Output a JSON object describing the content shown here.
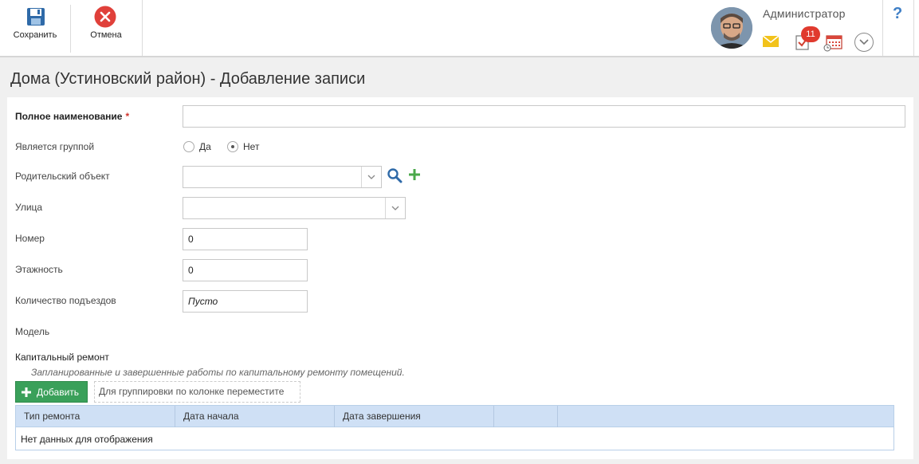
{
  "toolbar": {
    "save_label": "Сохранить",
    "cancel_label": "Отмена",
    "icons": {
      "save": "floppy-disk-icon",
      "cancel": "close-circle-icon"
    }
  },
  "user": {
    "name": "Администратор",
    "notifications_count": "11",
    "icons": [
      "mail-icon",
      "tasks-icon",
      "calendar-icon",
      "chevron-down-icon"
    ],
    "help_label": "?"
  },
  "page": {
    "title": "Дома (Устиновский район) - Добавление записи"
  },
  "form": {
    "full_name_label": "Полное наименование",
    "required_mark": "*",
    "full_name_value": "",
    "is_group_label": "Является группой",
    "is_group_options": [
      "Да",
      "Нет"
    ],
    "is_group_selected": "Нет",
    "parent_label": "Родительский объект",
    "parent_value": "",
    "street_label": "Улица",
    "street_value": "",
    "number_label": "Номер",
    "number_value": "0",
    "floors_label": "Этажность",
    "floors_value": "0",
    "entrances_label": "Количество подъездов",
    "entrances_placeholder": "Пусто",
    "model_label": "Модель"
  },
  "repairs": {
    "title": "Капитальный ремонт",
    "description": "Запланированные и завершенные работы по капитальному ремонту помещений.",
    "add_label": "Добавить",
    "group_hint": "Для группировки по колонке переместите",
    "columns": [
      "Тип ремонта",
      "Дата начала",
      "Дата завершения",
      ""
    ],
    "empty_text": "Нет данных для отображения"
  },
  "colors": {
    "accent_green": "#3aa05a",
    "grid_header": "#cfe0f5",
    "badge_red": "#e03a2e",
    "cancel_red": "#e0403a",
    "mail_yellow": "#f2c21b",
    "help_blue": "#3f7fc6"
  }
}
